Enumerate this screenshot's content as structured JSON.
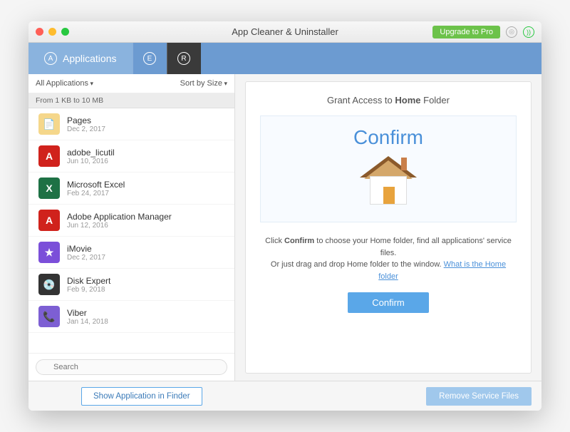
{
  "window": {
    "title": "App Cleaner & Uninstaller"
  },
  "titlebar": {
    "upgrade": "Upgrade to Pro"
  },
  "tabs": {
    "applications": "Applications",
    "e_label": "E",
    "r_label": "R"
  },
  "filter": {
    "scope": "All Applications",
    "sort": "Sort by Size"
  },
  "group": {
    "header": "From 1 KB to 10 MB"
  },
  "apps": [
    {
      "name": "Pages",
      "date": "Dec 2, 2017",
      "bg": "#f5d78b",
      "glyph": "📄"
    },
    {
      "name": "adobe_licutil",
      "date": "Jun 10, 2016",
      "bg": "#d0221c",
      "glyph": "A"
    },
    {
      "name": "Microsoft Excel",
      "date": "Feb 24, 2017",
      "bg": "#1e7145",
      "glyph": "X"
    },
    {
      "name": "Adobe Application Manager",
      "date": "Jun 12, 2016",
      "bg": "#d0221c",
      "glyph": "A"
    },
    {
      "name": "iMovie",
      "date": "Dec 2, 2017",
      "bg": "#7b4fd9",
      "glyph": "★"
    },
    {
      "name": "Disk Expert",
      "date": "Feb 9, 2018",
      "bg": "#333",
      "glyph": "💿"
    },
    {
      "name": "Viber",
      "date": "Jan 14, 2018",
      "bg": "#7d5fd3",
      "glyph": "📞"
    }
  ],
  "search": {
    "placeholder": "Search"
  },
  "panel": {
    "grant_pre": "Grant Access to ",
    "grant_bold": "Home",
    "grant_post": " Folder",
    "hero_title": "Confirm",
    "line1_pre": "Click ",
    "line1_bold": "Confirm",
    "line1_post": " to choose your Home folder, find all applications' service files.",
    "line2": "Or just drag and drop Home folder to the window. ",
    "link": "What is the Home folder",
    "confirm_btn": "Confirm"
  },
  "footer": {
    "show_in_finder": "Show Application in Finder",
    "remove": "Remove Service Files"
  }
}
